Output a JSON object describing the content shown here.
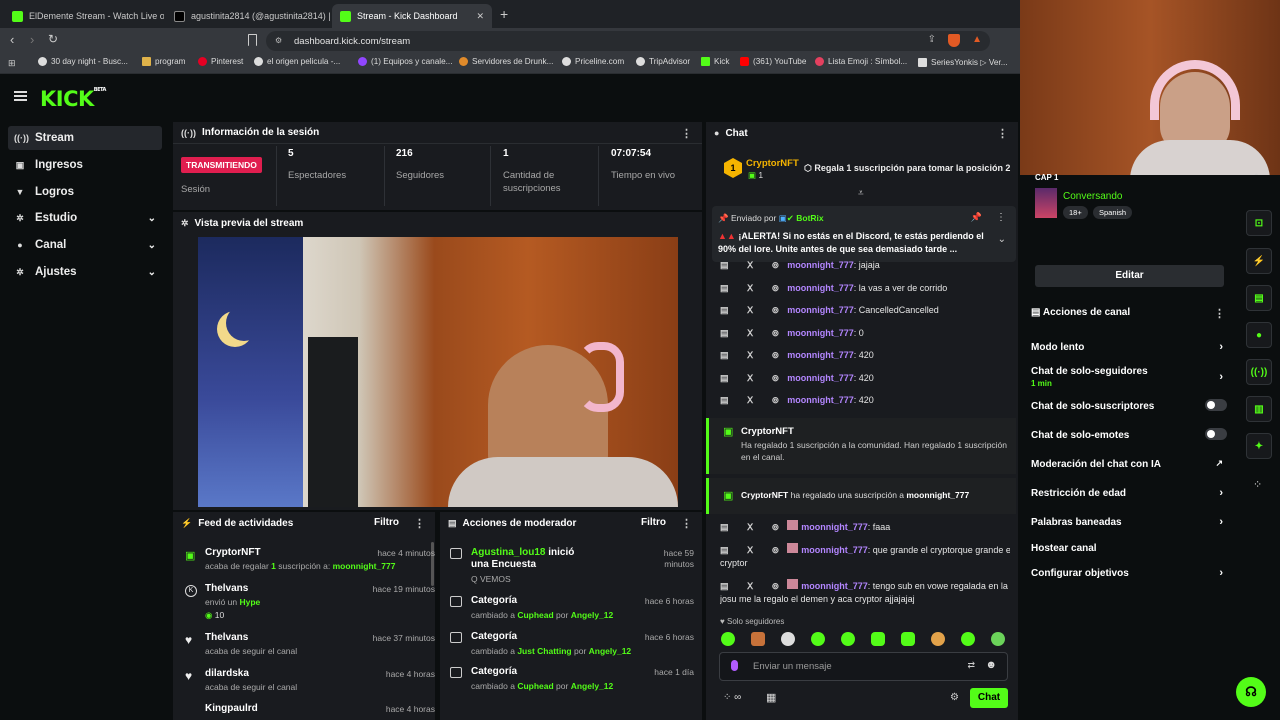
{
  "browser": {
    "tabs": [
      {
        "title": "ElDemente Stream - Watch Live on K",
        "active": false
      },
      {
        "title": "agustinita2814 (@agustinita2814) | T",
        "active": false
      },
      {
        "title": "Stream - Kick Dashboard",
        "active": true
      }
    ],
    "url": "dashboard.kick.com/stream",
    "bookmarks": [
      "30 day night - Busc...",
      "program",
      "Pinterest",
      "el origen pelicula -...",
      "(1) Equipos y canale...",
      "Servidores de Drunk...",
      "Priceline.com",
      "TripAdvisor",
      "Kick",
      "(361) YouTube",
      "Lista Emoji : Símbol...",
      "SeriesYonkis ▷ Ver..."
    ]
  },
  "brand": {
    "logo": "KICK",
    "beta": "BETA",
    "accent": "#53fc18"
  },
  "sidebar": {
    "items": [
      {
        "label": "Stream",
        "icon": "broadcast-icon",
        "expandable": false,
        "active": true
      },
      {
        "label": "Ingresos",
        "icon": "money-icon",
        "expandable": false,
        "active": false
      },
      {
        "label": "Logros",
        "icon": "trophy-icon",
        "expandable": false,
        "active": false
      },
      {
        "label": "Estudio",
        "icon": "gear-icon",
        "expandable": true,
        "active": false
      },
      {
        "label": "Canal",
        "icon": "users-icon",
        "expandable": true,
        "active": false
      },
      {
        "label": "Ajustes",
        "icon": "settings-icon",
        "expandable": true,
        "active": false
      }
    ]
  },
  "session": {
    "title": "Información de la sesión",
    "status_badge": "TRANSMITIENDO",
    "status_label": "Sesión",
    "stats": [
      {
        "value": "5",
        "label": "Espectadores"
      },
      {
        "value": "216",
        "label": "Seguidores"
      },
      {
        "value": "1",
        "label": "Cantidad de suscripciones"
      },
      {
        "value": "07:07:54",
        "label": "Tiempo en vivo"
      }
    ]
  },
  "preview": {
    "title": "Vista previa del stream"
  },
  "feed": {
    "title": "Feed de actividades",
    "filter": "Filtro",
    "items": [
      {
        "name": "CryptorNFT",
        "time": "hace 4 minutos",
        "pre": "acaba de regalar ",
        "count": "1",
        "mid": " suscripción a: ",
        "target": "moonnight_777"
      },
      {
        "name": "Thelvans",
        "time": "hace 19 minutos",
        "pre": "envió un ",
        "target": "Hype",
        "extra": "10"
      },
      {
        "name": "Thelvans",
        "time": "hace 37 minutos",
        "pre": "acaba de seguir el canal"
      },
      {
        "name": "dilardska",
        "time": "hace 4 horas",
        "pre": "acaba de seguir el canal"
      },
      {
        "name": "Kingpaulrd",
        "time": "hace 4 horas"
      }
    ]
  },
  "moderator": {
    "title": "Acciones de moderador",
    "filter": "Filtro",
    "items": [
      {
        "user": "Agustina_lou18",
        "action": " inició una Encuesta",
        "time": "hace 59 minutos",
        "sub": "Q VEMOS"
      },
      {
        "action": "Categoría",
        "time": "hace 6 horas",
        "pre": "cambiado a ",
        "cat": "Cuphead",
        "by": " por ",
        "who": "Angely_12"
      },
      {
        "action": "Categoría",
        "time": "hace 6 horas",
        "pre": "cambiado a ",
        "cat": "Just Chatting",
        "by": " por ",
        "who": "Angely_12"
      },
      {
        "action": "Categoría",
        "time": "hace 1 día",
        "pre": "cambiado a ",
        "cat": "Cuphead",
        "by": " por ",
        "who": "Angely_12"
      }
    ]
  },
  "chat": {
    "title": "Chat",
    "pinned_gifter": {
      "name": "CryptorNFT",
      "count": "1",
      "cta": "Regala 1 suscripción para tomar la posición 2"
    },
    "pinned_msg": {
      "label": "Enviado por",
      "by": "BotRix",
      "text": "¡ALERTA! Si no estás en el Discord, te estás perdiendo el 90% del lore. Unite antes de que sea demasiado tarde ..."
    },
    "messages": [
      {
        "user": "moonnight_777",
        "text": ": jajaja"
      },
      {
        "user": "moonnight_777",
        "text": ": la vas a ver de corrido"
      },
      {
        "user": "moonnight_777",
        "text": ": CancelledCancelled"
      },
      {
        "user": "moonnight_777",
        "text": ": 0"
      },
      {
        "user": "moonnight_777",
        "text": ": 420"
      },
      {
        "user": "moonnight_777",
        "text": ": 420"
      },
      {
        "user": "moonnight_777",
        "text": ": 420"
      }
    ],
    "gift_event": {
      "name": "CryptorNFT",
      "text": "Ha regalado 1 suscripción a la comunidad. Han regalado 1 suscripción en el canal."
    },
    "gift_event2": {
      "name": "CryptorNFT",
      "mid": " ha regalado una suscripción a ",
      "target": "moonnight_777"
    },
    "messages2": [
      {
        "user": "moonnight_777",
        "text": ": faaa"
      },
      {
        "user": "moonnight_777",
        "text": ": que grande el cryptorque grande el",
        "cont": "cryptor"
      },
      {
        "user": "moonnight_777",
        "text": ": tengo sub en vowe regalada en la de",
        "cont": "josu me la regalo el demen y aca cryptor ajjajajaj"
      }
    ],
    "followers_only": "Solo seguidores",
    "input_placeholder": "Enviar un mensaje",
    "send": "Chat"
  },
  "stream_info": {
    "category_short": "CAP 1",
    "status": "Conversando",
    "age": "18+",
    "language": "Spanish",
    "edit": "Editar"
  },
  "channel_actions": {
    "title": "Acciones de canal",
    "items": [
      {
        "label": "Modo lento",
        "kind": "chevron"
      },
      {
        "label": "Chat de solo-seguidores",
        "sub": "1 min",
        "kind": "chevron"
      },
      {
        "label": "Chat de solo-suscriptores",
        "kind": "toggle"
      },
      {
        "label": "Chat de solo-emotes",
        "kind": "toggle"
      },
      {
        "label": "Moderación del chat con IA",
        "kind": "external"
      },
      {
        "label": "Restricción de edad",
        "kind": "chevron"
      },
      {
        "label": "Palabras baneadas",
        "kind": "chevron"
      },
      {
        "label": "Hostear canal",
        "kind": "none"
      },
      {
        "label": "Configurar objetivos",
        "kind": "chevron"
      }
    ]
  }
}
